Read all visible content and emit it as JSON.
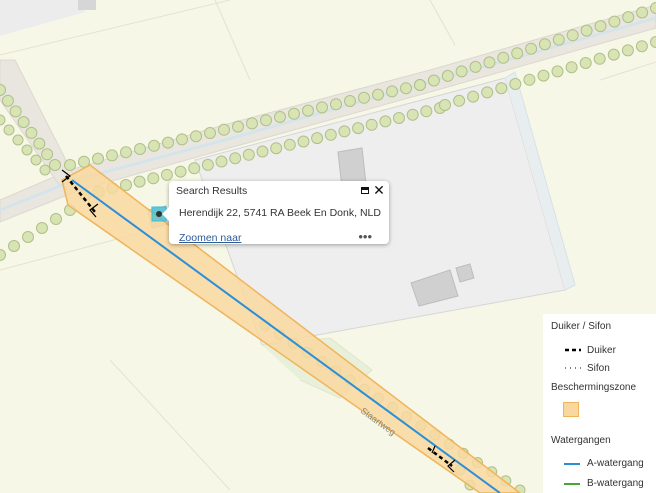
{
  "map": {
    "road_label": "Staartweg",
    "colors": {
      "field": "#f6f7e6",
      "parcel": "#efefef",
      "building": "#d0d0d0",
      "road": "#e8e4dc",
      "ditch": "#cfe0ea",
      "tree_fill": "#d8e4b4",
      "tree_stroke": "#b0bf8a",
      "zone_fill": "#f9d8a0",
      "zone_stroke": "#f0b45a",
      "a_watergang": "#2b8fd8",
      "b_watergang": "#4aa630",
      "marker": "#36c0d8"
    }
  },
  "popup": {
    "title": "Search Results",
    "address": "Herendijk 22, 5741 RA Beek En Donk, NLD",
    "zoom_link": "Zoomen naar",
    "more": "•••",
    "close_glyph": "✕"
  },
  "legend": {
    "heading_1": "Duiker / Sifon",
    "item_duiker": "Duiker",
    "item_sifon": "Sifon",
    "heading_2": "Beschermingszone",
    "heading_3": "Watergangen",
    "item_a": "A-watergang",
    "item_b": "B-watergang"
  }
}
